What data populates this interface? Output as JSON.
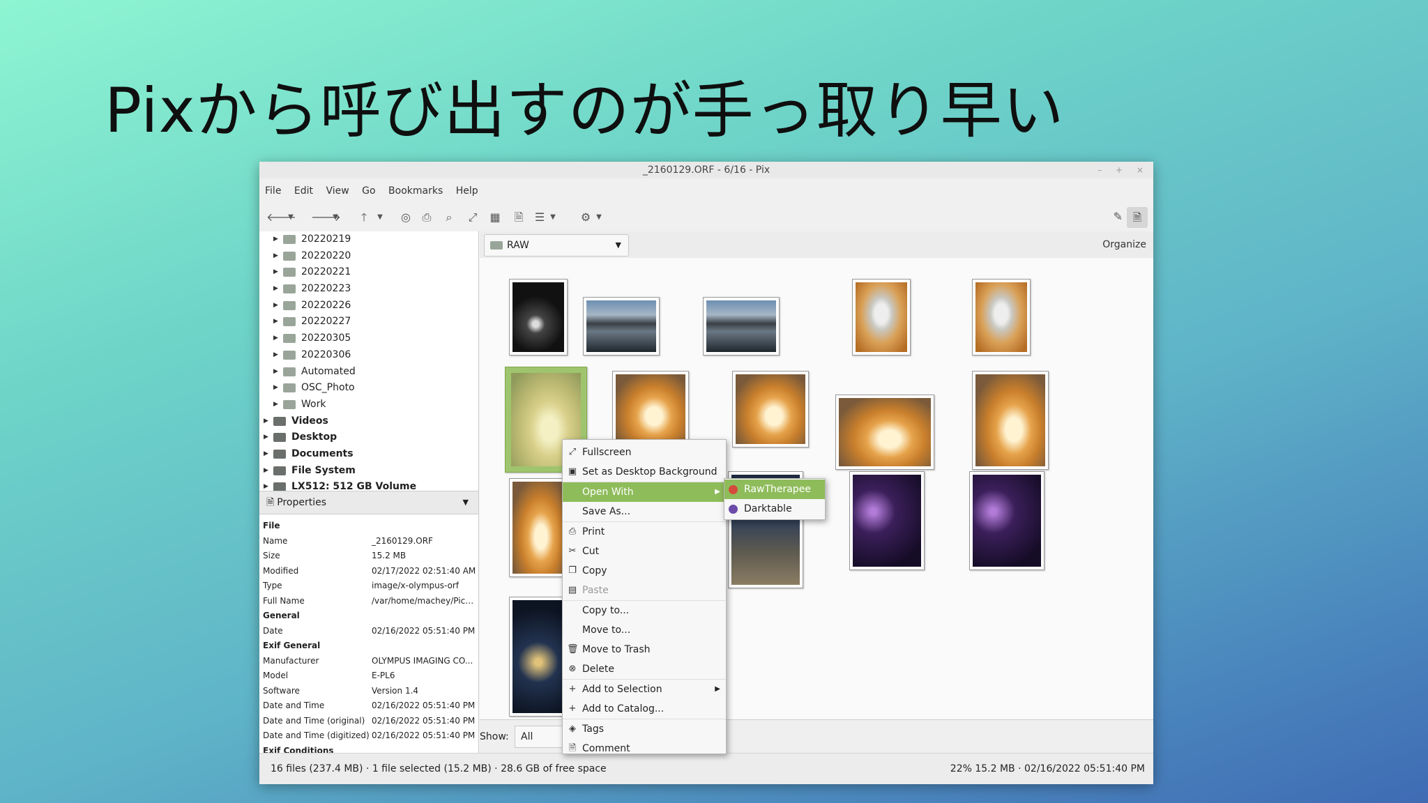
{
  "slide": {
    "title": "Pixから呼び出すのが手っ取り早い"
  },
  "window": {
    "title": "_2160129.ORF - 6/16 - Pix",
    "controls": [
      "–",
      "+",
      "×"
    ]
  },
  "menubar": {
    "items": [
      "File",
      "Edit",
      "View",
      "Go",
      "Bookmarks",
      "Help"
    ]
  },
  "folder_tree": {
    "items": [
      {
        "label": "20220219",
        "bold": false
      },
      {
        "label": "20220220",
        "bold": false
      },
      {
        "label": "20220221",
        "bold": false
      },
      {
        "label": "20220223",
        "bold": false
      },
      {
        "label": "20220226",
        "bold": false
      },
      {
        "label": "20220227",
        "bold": false
      },
      {
        "label": "20220305",
        "bold": false
      },
      {
        "label": "20220306",
        "bold": false
      },
      {
        "label": "Automated",
        "bold": false
      },
      {
        "label": "OSC_Photo",
        "bold": false
      },
      {
        "label": "Work",
        "bold": false
      },
      {
        "label": "Videos",
        "bold": true
      },
      {
        "label": "Desktop",
        "bold": true
      },
      {
        "label": "Documents",
        "bold": true
      },
      {
        "label": "File System",
        "bold": true
      },
      {
        "label": "LX512: 512 GB Volume",
        "bold": true
      }
    ]
  },
  "properties": {
    "header": "Properties",
    "rows": [
      {
        "key": "File",
        "value": "",
        "section": true
      },
      {
        "key": "Name",
        "value": "_2160129.ORF"
      },
      {
        "key": "Size",
        "value": "15.2 MB"
      },
      {
        "key": "Modified",
        "value": "02/17/2022 02:51:40 AM"
      },
      {
        "key": "Type",
        "value": "image/x-olympus-orf"
      },
      {
        "key": "Full Name",
        "value": "/var/home/machey/Pict..."
      },
      {
        "key": "General",
        "value": "",
        "section": true
      },
      {
        "key": "Date",
        "value": "02/16/2022 05:51:40 PM"
      },
      {
        "key": "Exif General",
        "value": "",
        "section": true
      },
      {
        "key": "Manufacturer",
        "value": "OLYMPUS IMAGING CO..."
      },
      {
        "key": "Model",
        "value": "E-PL6"
      },
      {
        "key": "Software",
        "value": "Version 1.4"
      },
      {
        "key": "Date and Time",
        "value": "02/16/2022 05:51:40 PM"
      },
      {
        "key": "Date and Time (original)",
        "value": "02/16/2022 05:51:40 PM"
      },
      {
        "key": "Date and Time (digitized)",
        "value": "02/16/2022 05:51:40 PM"
      },
      {
        "key": "Exif Conditions",
        "value": "",
        "section": true
      }
    ]
  },
  "browser": {
    "location": "RAW",
    "organize_label": "Organize",
    "show_label": "Show:",
    "show_value": "All"
  },
  "status": {
    "left": "16 files (237.4 MB) · 1 file selected (15.2 MB) · 28.6 GB of free space",
    "right": "22%  15.2 MB · 02/16/2022 05:51:40 PM"
  },
  "context_menu": {
    "items": [
      {
        "label": "Fullscreen",
        "icon": "fullscreen-icon",
        "glyph": "⤢"
      },
      {
        "label": "Set as Desktop Background",
        "icon": "desktop-background-icon",
        "glyph": "▣"
      },
      {
        "label": "Open With",
        "icon": "",
        "glyph": "",
        "submenu": true,
        "highlighted": true
      },
      {
        "label": "Save As...",
        "icon": "",
        "glyph": ""
      },
      {
        "label": "Print",
        "icon": "print-icon",
        "glyph": "⎙"
      },
      {
        "label": "Cut",
        "icon": "cut-icon",
        "glyph": "✂"
      },
      {
        "label": "Copy",
        "icon": "copy-icon",
        "glyph": "❐"
      },
      {
        "label": "Paste",
        "icon": "paste-icon",
        "glyph": "▤",
        "disabled": true
      },
      {
        "label": "Copy to...",
        "icon": "",
        "glyph": ""
      },
      {
        "label": "Move to...",
        "icon": "",
        "glyph": ""
      },
      {
        "label": "Move to Trash",
        "icon": "trash-icon",
        "glyph": "🗑"
      },
      {
        "label": "Delete",
        "icon": "delete-icon",
        "glyph": "⊗"
      },
      {
        "label": "Add to Selection",
        "icon": "add-icon",
        "glyph": "+",
        "submenu": true
      },
      {
        "label": "Add to Catalog...",
        "icon": "add-icon",
        "glyph": "+"
      },
      {
        "label": "Tags",
        "icon": "tag-icon",
        "glyph": "◈"
      },
      {
        "label": "Comment",
        "icon": "comment-icon",
        "glyph": "🗎"
      }
    ]
  },
  "open_with_submenu": {
    "items": [
      {
        "label": "RawTherapee",
        "highlighted": true,
        "color": "#d44c3b"
      },
      {
        "label": "Darktable",
        "highlighted": false,
        "color": "#6b4ca8"
      }
    ]
  },
  "colors": {
    "selection": "#8fbc5b",
    "background_top": "#8ef5d2",
    "background_bottom": "#3f6bb4"
  }
}
